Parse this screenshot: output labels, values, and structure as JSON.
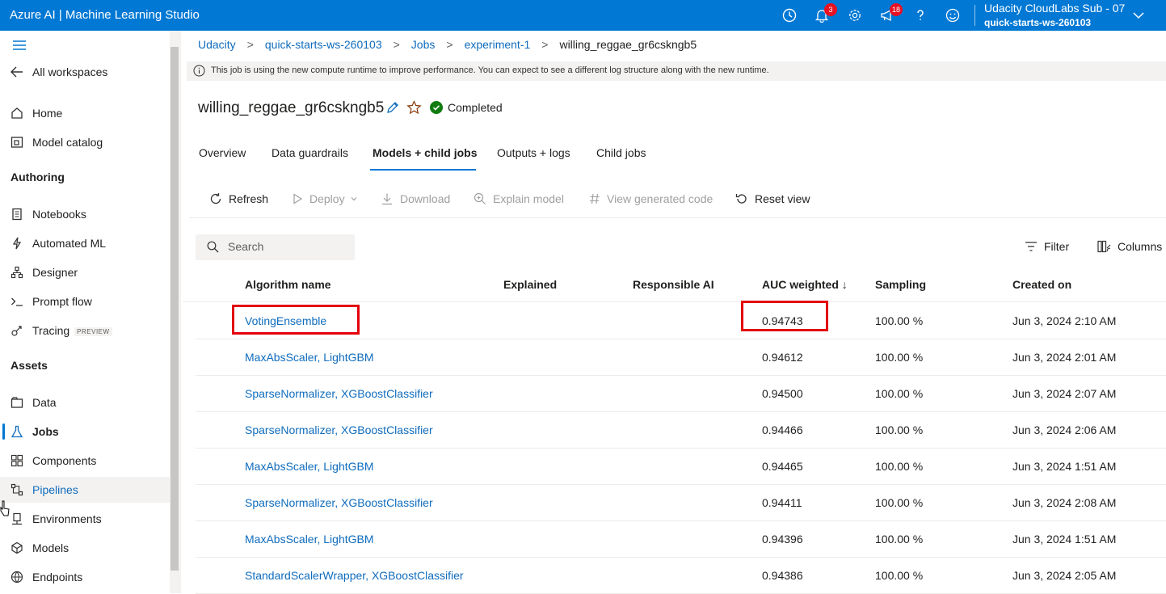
{
  "header": {
    "title": "Azure AI | Machine Learning Studio",
    "notifications_count": "3",
    "feedback_count": "18",
    "account_name": "Udacity CloudLabs Sub - 07",
    "workspace_name": "quick-starts-ws-260103"
  },
  "sidebar": {
    "all_workspaces": "All workspaces",
    "items_top": [
      {
        "label": "Home",
        "icon": "home-icon"
      },
      {
        "label": "Model catalog",
        "icon": "catalog-icon"
      }
    ],
    "authoring_header": "Authoring",
    "authoring_items": [
      {
        "label": "Notebooks",
        "icon": "notebook-icon"
      },
      {
        "label": "Automated ML",
        "icon": "automl-icon"
      },
      {
        "label": "Designer",
        "icon": "designer-icon"
      },
      {
        "label": "Prompt flow",
        "icon": "prompt-icon"
      },
      {
        "label": "Tracing",
        "icon": "tracing-icon",
        "tag": "PREVIEW"
      }
    ],
    "assets_header": "Assets",
    "asset_items": [
      {
        "label": "Data",
        "icon": "data-icon"
      },
      {
        "label": "Jobs",
        "icon": "flask-icon"
      },
      {
        "label": "Components",
        "icon": "components-icon"
      },
      {
        "label": "Pipelines",
        "icon": "pipelines-icon"
      },
      {
        "label": "Environments",
        "icon": "environment-icon"
      },
      {
        "label": "Models",
        "icon": "model-icon"
      },
      {
        "label": "Endpoints",
        "icon": "endpoint-icon"
      }
    ]
  },
  "breadcrumb": [
    "Udacity",
    "quick-starts-ws-260103",
    "Jobs",
    "experiment-1",
    "willing_reggae_gr6cskngb5"
  ],
  "info_message": "This job is using the new compute runtime to improve performance. You can expect to see a different log structure along with the new runtime.",
  "job": {
    "name": "willing_reggae_gr6cskngb5",
    "status": "Completed",
    "status_color": "#107c10"
  },
  "tabs": [
    "Overview",
    "Data guardrails",
    "Models + child jobs",
    "Outputs + logs",
    "Child jobs"
  ],
  "active_tab": "Models + child jobs",
  "toolbar": {
    "refresh": "Refresh",
    "deploy": "Deploy",
    "download": "Download",
    "explain": "Explain model",
    "view_code": "View generated code",
    "reset": "Reset view"
  },
  "search": {
    "placeholder": "Search"
  },
  "table_tools": {
    "filter": "Filter",
    "columns": "Columns"
  },
  "table": {
    "columns": [
      "Algorithm name",
      "Explained",
      "Responsible AI",
      "AUC weighted ↓",
      "Sampling",
      "Created on"
    ],
    "rows": [
      {
        "algorithm": "VotingEnsemble",
        "auc": "0.94743",
        "sampling": "100.00 %",
        "created": "Jun 3, 2024 2:10 AM"
      },
      {
        "algorithm": "MaxAbsScaler, LightGBM",
        "auc": "0.94612",
        "sampling": "100.00 %",
        "created": "Jun 3, 2024 2:01 AM"
      },
      {
        "algorithm": "SparseNormalizer, XGBoostClassifier",
        "auc": "0.94500",
        "sampling": "100.00 %",
        "created": "Jun 3, 2024 2:07 AM"
      },
      {
        "algorithm": "SparseNormalizer, XGBoostClassifier",
        "auc": "0.94466",
        "sampling": "100.00 %",
        "created": "Jun 3, 2024 2:06 AM"
      },
      {
        "algorithm": "MaxAbsScaler, LightGBM",
        "auc": "0.94465",
        "sampling": "100.00 %",
        "created": "Jun 3, 2024 1:51 AM"
      },
      {
        "algorithm": "SparseNormalizer, XGBoostClassifier",
        "auc": "0.94411",
        "sampling": "100.00 %",
        "created": "Jun 3, 2024 2:08 AM"
      },
      {
        "algorithm": "MaxAbsScaler, LightGBM",
        "auc": "0.94396",
        "sampling": "100.00 %",
        "created": "Jun 3, 2024 1:51 AM"
      },
      {
        "algorithm": "StandardScalerWrapper, XGBoostClassifier",
        "auc": "0.94386",
        "sampling": "100.00 %",
        "created": "Jun 3, 2024 2:05 AM"
      }
    ]
  },
  "colors": {
    "brand": "#0078d4",
    "link": "#0f6cbd",
    "highlight": "#e3000b"
  }
}
